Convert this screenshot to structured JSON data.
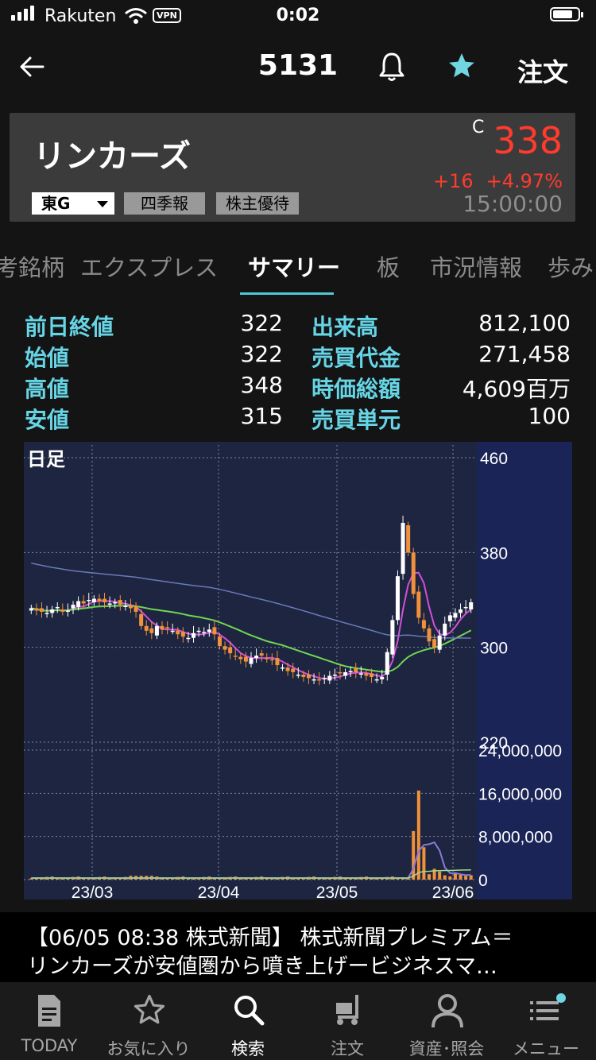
{
  "status_bar": {
    "carrier": "Rakuten",
    "vpn": "VPN",
    "time": "0:02"
  },
  "header": {
    "title": "5131",
    "order_label": "注文",
    "back_icon": "back-arrow-icon",
    "bell_icon": "bell-icon",
    "favorite_icon": "star-icon",
    "favorite_color": "#6fd6e2"
  },
  "stock": {
    "name": "リンカーズ",
    "price_flag": "C",
    "price": "338",
    "change": "+16",
    "change_pct": "+4.97%",
    "time": "15:00:00",
    "market": "東G",
    "badge_shikiho": "四季報",
    "badge_yutai": "株主優待",
    "up_color": "#ff3b2e"
  },
  "tabs": [
    {
      "label": "考銘柄"
    },
    {
      "label": "エクスプレス"
    },
    {
      "label": "サマリー",
      "active": true
    },
    {
      "label": "板"
    },
    {
      "label": "市況情報"
    },
    {
      "label": "歩み"
    }
  ],
  "summary": {
    "left": [
      {
        "label": "前日終値",
        "value": "322"
      },
      {
        "label": "始値",
        "value": "322"
      },
      {
        "label": "高値",
        "value": "348"
      },
      {
        "label": "安値",
        "value": "315"
      }
    ],
    "right": [
      {
        "label": "出来高",
        "value": "812,100"
      },
      {
        "label": "売買代金",
        "value": "271,458"
      },
      {
        "label": "時価総額",
        "value": "4,609百万"
      },
      {
        "label": "売買単元",
        "value": "100"
      }
    ]
  },
  "chart_data": {
    "type": "candlestick",
    "title": "日足",
    "price_axis": {
      "ticks": [
        "460",
        "380",
        "300",
        "220"
      ],
      "ylim": [
        220,
        460
      ]
    },
    "volume_axis": {
      "ticks": [
        "24,000,000",
        "16,000,000",
        "8,000,000",
        "0"
      ],
      "ylim": [
        0,
        24000000
      ]
    },
    "x_ticks": [
      "23/03",
      "23/04",
      "23/05",
      "23/06"
    ],
    "up_color": "#ffffff",
    "down_color": "#f0913c",
    "ma_colors": {
      "short": "#d24fd8",
      "mid": "#6fd652",
      "long": "#6a7ab8"
    },
    "closes": [
      333,
      331,
      330,
      329,
      332,
      334,
      330,
      331,
      336,
      339,
      337,
      340,
      341,
      339,
      338,
      337,
      338,
      336,
      335,
      333,
      330,
      318,
      314,
      312,
      318,
      315,
      316,
      314,
      311,
      309,
      308,
      312,
      314,
      313,
      315,
      311,
      301,
      298,
      295,
      292,
      290,
      288,
      291,
      293,
      293,
      290,
      289,
      285,
      283,
      280,
      279,
      277,
      275,
      274,
      273,
      272,
      274,
      276,
      277,
      278,
      279,
      280,
      279,
      278,
      276,
      275,
      273,
      275,
      296,
      323,
      360,
      405,
      380,
      345,
      325,
      316,
      305,
      300,
      310,
      320,
      327,
      329,
      332,
      334,
      338
    ],
    "volume_peak": 16500000,
    "volume_bars_at_end": [
      9000000,
      16500000,
      6000000,
      1000000,
      2000000,
      1500000,
      800000,
      600000,
      1200000,
      900000,
      700000,
      812100
    ]
  },
  "news": {
    "line1": "【06/05 08:38 株式新聞】 株式新聞プレミアム＝",
    "line2": "リンカーズが安値圏から噴き上げービジネスマ…"
  },
  "tabbar": [
    {
      "label": "TODAY",
      "icon": "today-document-icon"
    },
    {
      "label": "お気に入り",
      "icon": "star-outline-icon"
    },
    {
      "label": "検索",
      "icon": "search-icon",
      "active": true
    },
    {
      "label": "注文",
      "icon": "cart-icon"
    },
    {
      "label": "資産･照会",
      "icon": "person-icon"
    },
    {
      "label": "メニュー",
      "icon": "menu-icon"
    }
  ]
}
